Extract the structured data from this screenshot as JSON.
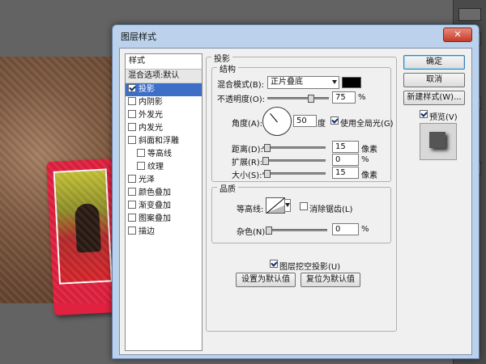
{
  "dialog": {
    "title": "图层样式",
    "close_label": "✕"
  },
  "styles_list": {
    "header": "样式",
    "blend_default": "混合选项:默认",
    "items": [
      {
        "label": "投影",
        "checked": true,
        "selected": true,
        "sub": false
      },
      {
        "label": "内阴影",
        "checked": false,
        "selected": false,
        "sub": false
      },
      {
        "label": "外发光",
        "checked": false,
        "selected": false,
        "sub": false
      },
      {
        "label": "内发光",
        "checked": false,
        "selected": false,
        "sub": false
      },
      {
        "label": "斜面和浮雕",
        "checked": false,
        "selected": false,
        "sub": false
      },
      {
        "label": "等高线",
        "checked": false,
        "selected": false,
        "sub": true
      },
      {
        "label": "纹理",
        "checked": false,
        "selected": false,
        "sub": true
      },
      {
        "label": "光泽",
        "checked": false,
        "selected": false,
        "sub": false
      },
      {
        "label": "颜色叠加",
        "checked": false,
        "selected": false,
        "sub": false
      },
      {
        "label": "渐变叠加",
        "checked": false,
        "selected": false,
        "sub": false
      },
      {
        "label": "图案叠加",
        "checked": false,
        "selected": false,
        "sub": false
      },
      {
        "label": "描边",
        "checked": false,
        "selected": false,
        "sub": false
      }
    ]
  },
  "drop_shadow": {
    "section_title": "投影",
    "structure_title": "结构",
    "blend_mode_label": "混合模式(B):",
    "blend_mode_value": "正片叠底",
    "shadow_color": "#000000",
    "opacity_label": "不透明度(O):",
    "opacity_value": "75",
    "opacity_unit": "%",
    "angle_label": "角度(A):",
    "angle_value": "50",
    "angle_unit": "度",
    "global_light_label": "使用全局光(G)",
    "global_light_checked": true,
    "distance_label": "距离(D):",
    "distance_value": "15",
    "distance_unit": "像素",
    "spread_label": "扩展(R):",
    "spread_value": "0",
    "spread_unit": "%",
    "size_label": "大小(S):",
    "size_value": "15",
    "size_unit": "像素",
    "quality_title": "品质",
    "contour_label": "等高线:",
    "anti_alias_label": "消除锯齿(L)",
    "anti_alias_checked": false,
    "noise_label": "杂色(N):",
    "noise_value": "0",
    "noise_unit": "%",
    "knockout_label": "图层挖空投影(U)",
    "knockout_checked": true,
    "make_default_label": "设置为默认值",
    "reset_default_label": "复位为默认值"
  },
  "actions": {
    "ok_label": "确定",
    "cancel_label": "取消",
    "new_style_label": "新建样式(W)...",
    "preview_label": "预览(V)",
    "preview_checked": true
  }
}
